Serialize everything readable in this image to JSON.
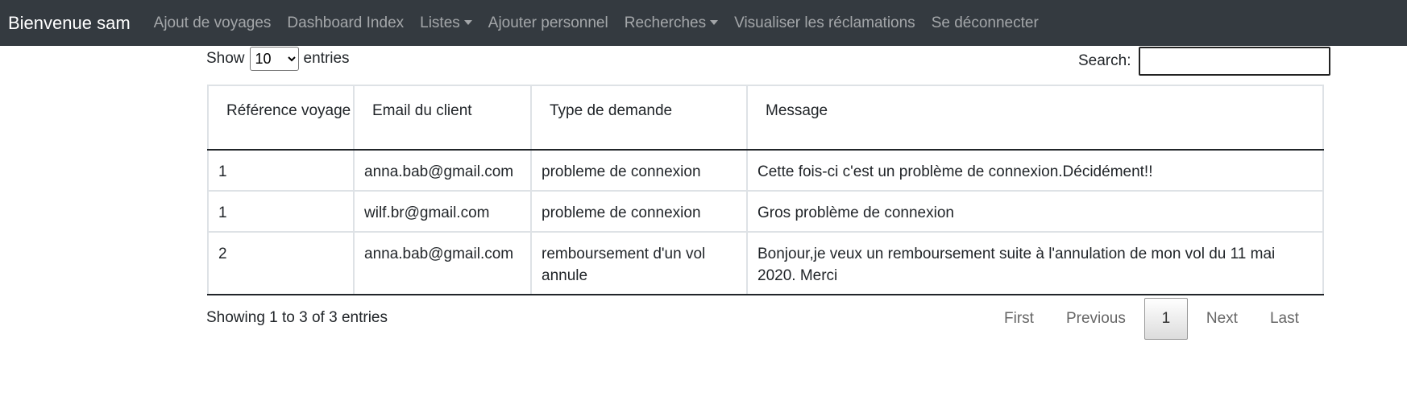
{
  "navbar": {
    "brand": "Bienvenue sam",
    "links": [
      {
        "label": "Ajout de voyages"
      },
      {
        "label": "Dashboard Index"
      },
      {
        "label": "Listes"
      },
      {
        "label": "Ajouter personnel"
      },
      {
        "label": "Recherches"
      },
      {
        "label": "Visualiser les réclamations"
      },
      {
        "label": "Se déconnecter"
      }
    ]
  },
  "controls": {
    "show_label": "Show",
    "entries_value": "10",
    "entries_label": "entries",
    "search_label": "Search:",
    "search_value": ""
  },
  "table": {
    "headers": [
      "Référence voyage",
      "Email du client",
      "Type de demande",
      "Message"
    ],
    "rows": [
      [
        "1",
        "anna.bab@gmail.com",
        "probleme de connexion",
        "Cette fois-ci c'est un problème de connexion.Décidément!!"
      ],
      [
        "1",
        "wilf.br@gmail.com",
        "probleme de connexion",
        "Gros problème de connexion"
      ],
      [
        "2",
        "anna.bab@gmail.com",
        "remboursement d'un vol annule",
        "Bonjour,je veux un remboursement suite à l'annulation de mon vol du 11 mai 2020. Merci"
      ]
    ]
  },
  "footer": {
    "info": "Showing 1 to 3 of 3 entries",
    "pagination": {
      "first": "First",
      "previous": "Previous",
      "current": "1",
      "next": "Next",
      "last": "Last"
    }
  },
  "colors": {
    "navbar_bg": "#343a40",
    "nav_link": "rgba(255,255,255,0.55)",
    "brand": "#ffffff"
  }
}
